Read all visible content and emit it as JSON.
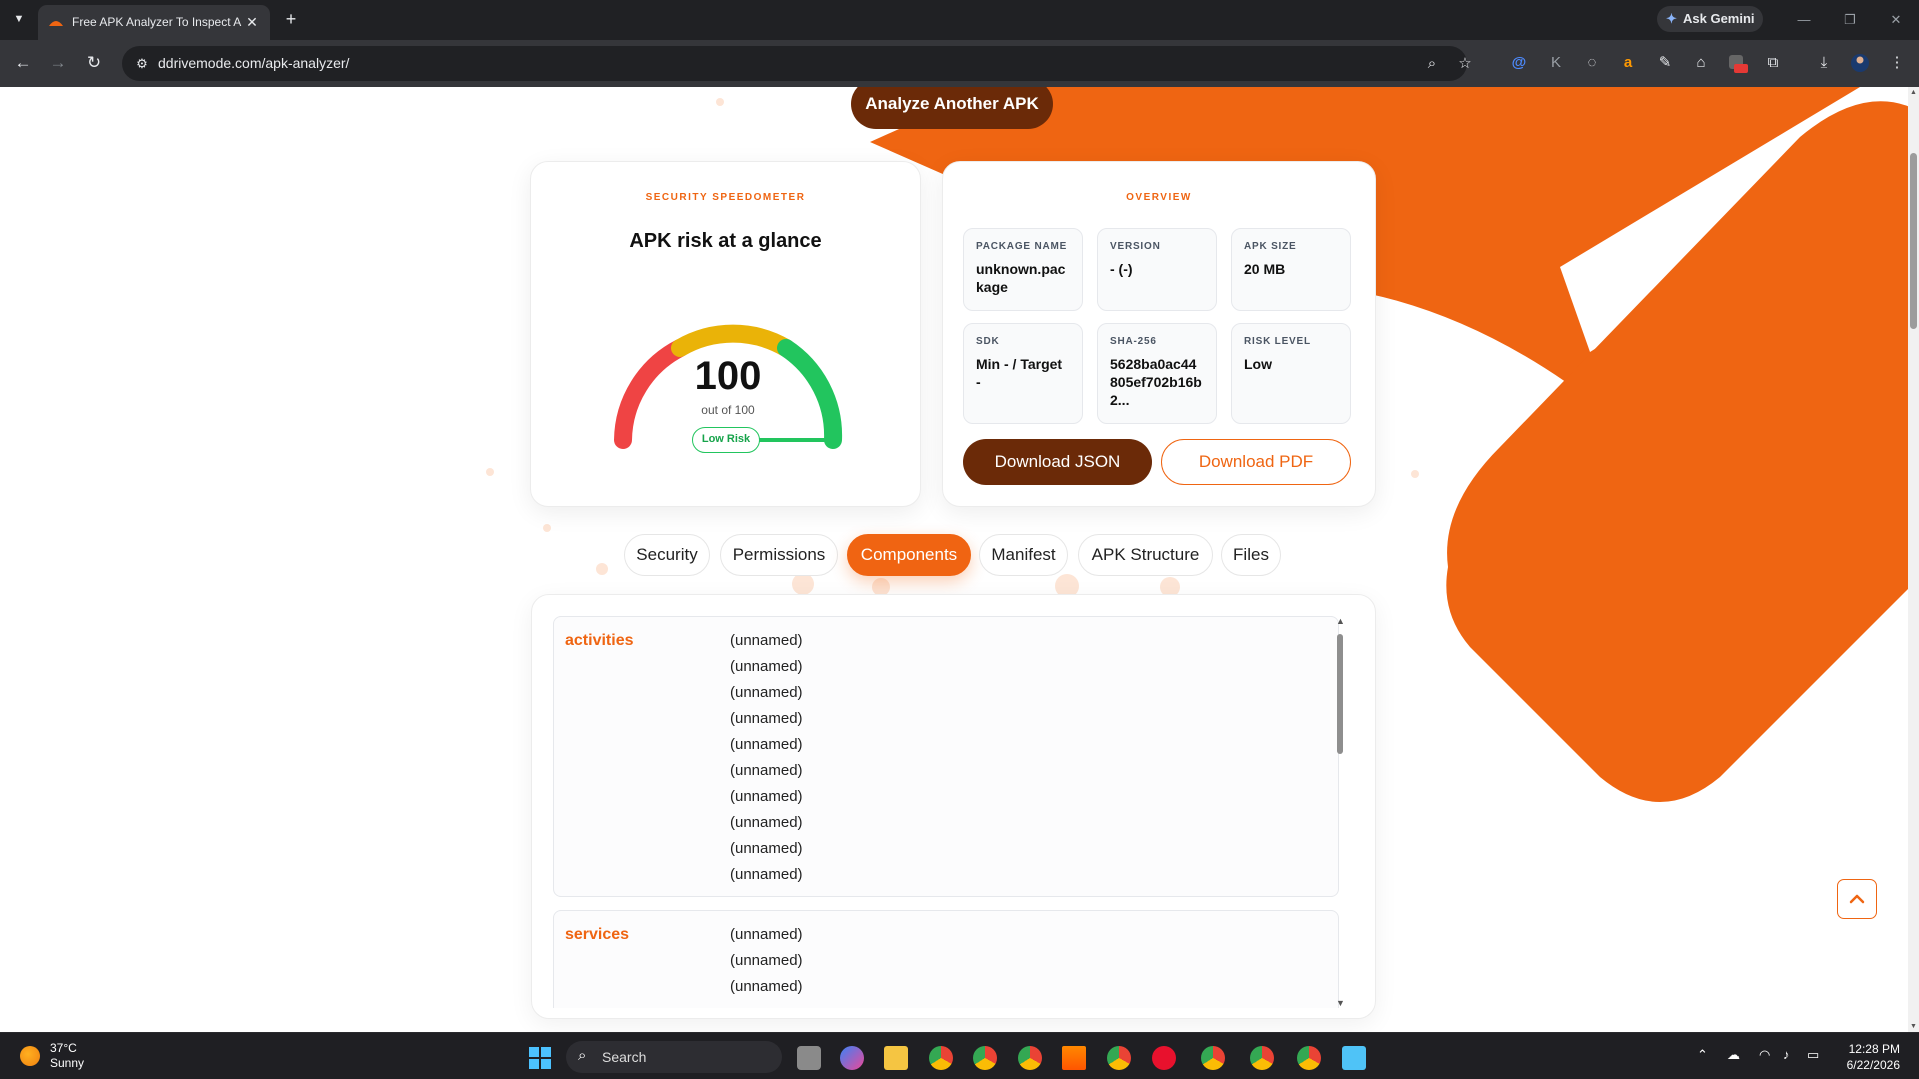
{
  "browser": {
    "tab_title": "Free APK Analyzer To Inspect A",
    "url": "ddrivemode.com/apk-analyzer/",
    "gemini_label": "Ask Gemini",
    "extension_badge": "off"
  },
  "page": {
    "analyze_button": "Analyze Another APK",
    "speedometer": {
      "kicker": "SECURITY SPEEDOMETER",
      "title": "APK risk at a glance",
      "score": "100",
      "out_of": "out of 100",
      "risk_label": "Low Risk",
      "score_value": 100,
      "score_max": 100
    },
    "overview": {
      "kicker": "OVERVIEW",
      "stats": [
        {
          "label": "PACKAGE NAME",
          "value": "unknown.package"
        },
        {
          "label": "VERSION",
          "value": "- (-)"
        },
        {
          "label": "APK SIZE",
          "value": "20 MB"
        },
        {
          "label": "SDK",
          "value": "Min - / Target -"
        },
        {
          "label": "SHA-256",
          "value": "5628ba0ac44805ef702b16b2..."
        },
        {
          "label": "RISK LEVEL",
          "value": "Low"
        }
      ],
      "download_json": "Download JSON",
      "download_pdf": "Download PDF"
    },
    "tabs": [
      "Security",
      "Permissions",
      "Components",
      "Manifest",
      "APK Structure",
      "Files"
    ],
    "active_tab": "Components",
    "components": [
      {
        "title": "activities",
        "items": [
          "(unnamed)",
          "(unnamed)",
          "(unnamed)",
          "(unnamed)",
          "(unnamed)",
          "(unnamed)",
          "(unnamed)",
          "(unnamed)",
          "(unnamed)",
          "(unnamed)"
        ]
      },
      {
        "title": "services",
        "items": [
          "(unnamed)",
          "(unnamed)",
          "(unnamed)"
        ]
      }
    ]
  },
  "taskbar": {
    "temperature": "37°C",
    "condition": "Sunny",
    "search_label": "Search",
    "time": "12:28 PM",
    "date": "6/22/2026"
  },
  "colors": {
    "accent": "#f06412",
    "dark_brown": "#6b2a08",
    "gauge_red": "#ef4444",
    "gauge_yellow": "#eab308",
    "gauge_green": "#22c55e"
  }
}
